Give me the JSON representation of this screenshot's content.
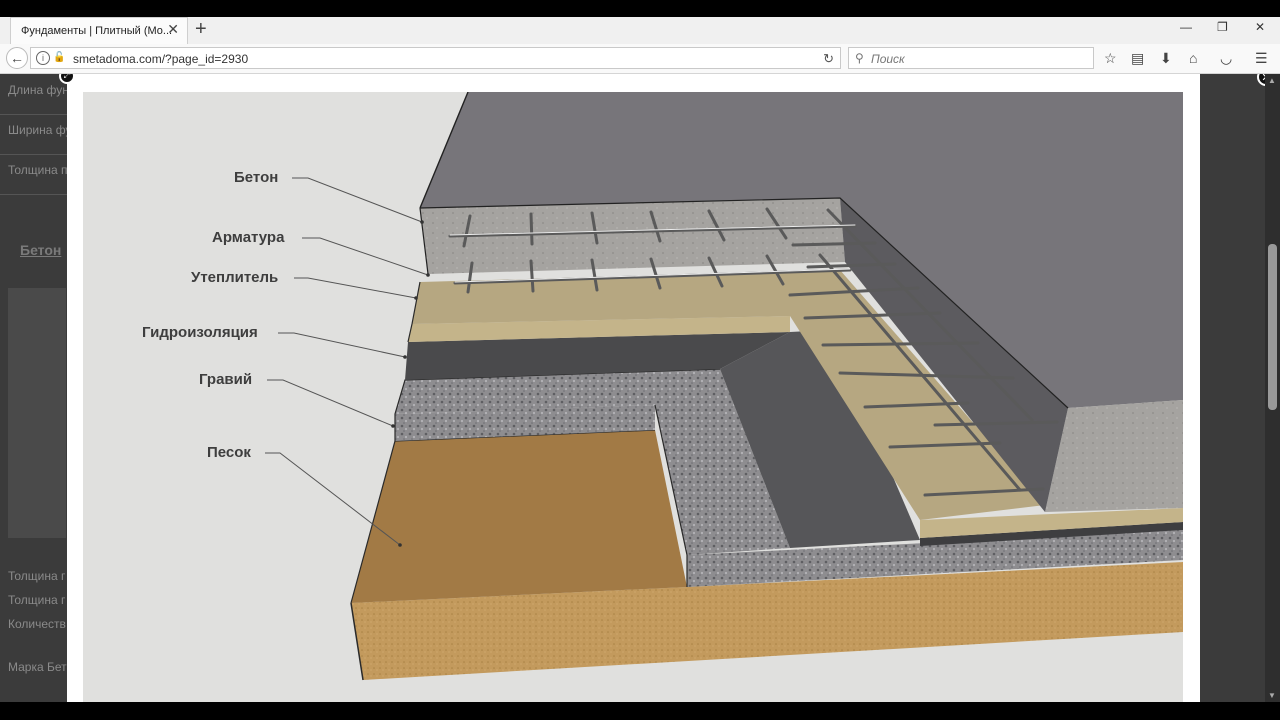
{
  "browser": {
    "tab_title": "Фундаменты | Плитный (Мо...",
    "tab_close": "✕",
    "new_tab": "+",
    "url": "smetadoma.com/?page_id=2930",
    "search_placeholder": "Поиск",
    "window_controls": [
      "—",
      "❐",
      "✕"
    ]
  },
  "background_page": {
    "fields": [
      "Длина фундамен",
      "Ширина фундамен",
      "Толщина плиты:"
    ],
    "section_label": "Бетон",
    "lower_fields": [
      "Толщина г",
      "Толщина г",
      "Количеств",
      "Марка Бет"
    ]
  },
  "diagram": {
    "labels": [
      "Бетон",
      "Арматура",
      "Утеплитель",
      "Гидроизоляция",
      "Гравий",
      "Песок"
    ]
  },
  "colors": {
    "concrete": "#a5a3a0",
    "concrete_top": "#77757a",
    "insulation": "#b6a781",
    "waterproofing": "#4a4a4c",
    "gravel": "#8e8d90",
    "sand": "#a27a45",
    "rebar": "#5a5a5a"
  }
}
